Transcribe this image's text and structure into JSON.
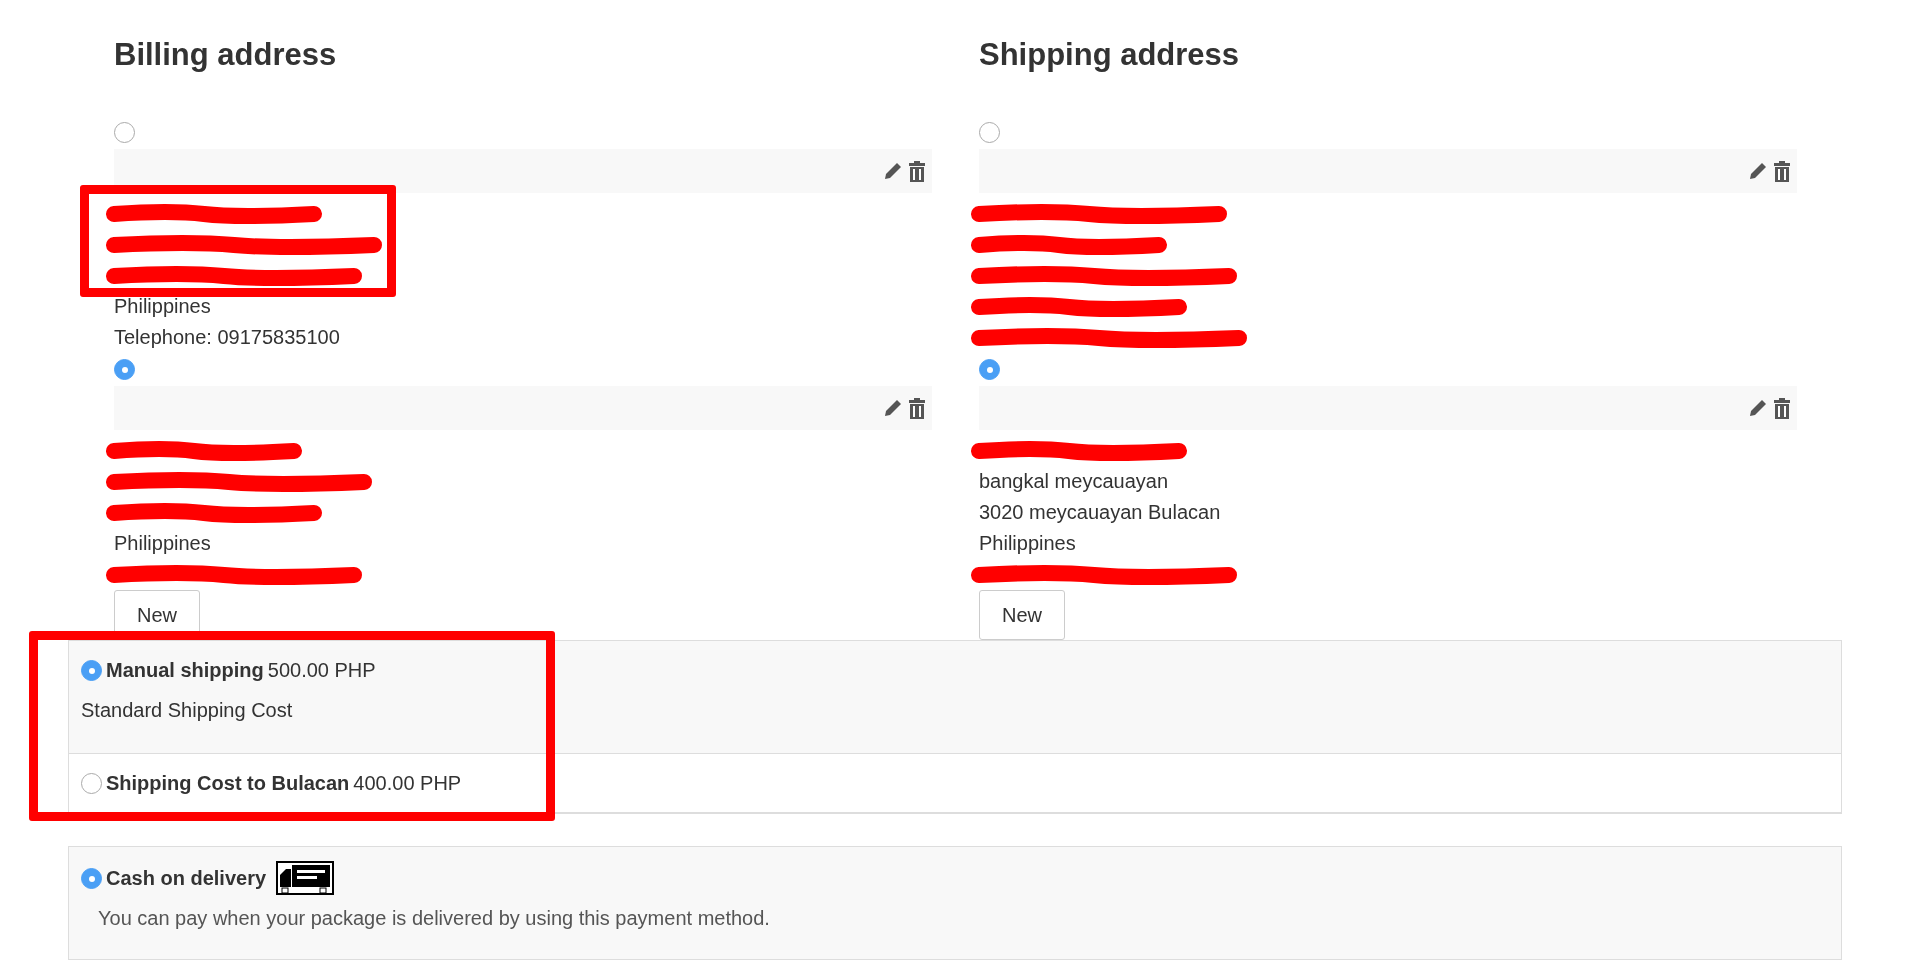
{
  "addresses": [
    {
      "title": "Billing address",
      "entries": [
        {
          "selected": false,
          "framed": true,
          "lines": [
            {
              "redacted": true
            },
            {
              "redacted": true
            },
            {
              "redacted": true
            },
            {
              "text": "Philippines"
            },
            {
              "text": "Telephone: 09175835100"
            }
          ]
        },
        {
          "selected": true,
          "lines": [
            {
              "redacted": true
            },
            {
              "redacted": true
            },
            {
              "redacted": true
            },
            {
              "text": "Philippines"
            },
            {
              "redacted": true
            }
          ]
        }
      ],
      "new_button": "New"
    },
    {
      "title": "Shipping address",
      "entries": [
        {
          "selected": false,
          "lines": [
            {
              "redacted": true
            },
            {
              "redacted": true
            },
            {
              "redacted": true
            },
            {
              "redacted": true
            },
            {
              "redacted": true
            }
          ]
        },
        {
          "selected": true,
          "lines": [
            {
              "redacted": true
            },
            {
              "text": "bangkal meycauayan"
            },
            {
              "text": "3020 meycauayan Bulacan"
            },
            {
              "text": "Philippines"
            },
            {
              "redacted": true
            }
          ]
        }
      ],
      "new_button": "New"
    }
  ],
  "shipping_methods": {
    "framed": true,
    "options": [
      {
        "name": "Manual shipping",
        "price": "500.00 PHP",
        "description": "Standard Shipping Cost",
        "selected": true
      },
      {
        "name": "Shipping Cost to Bulacan",
        "price": "400.00 PHP",
        "selected": false
      }
    ]
  },
  "payment_methods": [
    {
      "name": "Cash on delivery",
      "description": "You can pay when your package is delivered by using this payment method.",
      "selected": true
    }
  ]
}
